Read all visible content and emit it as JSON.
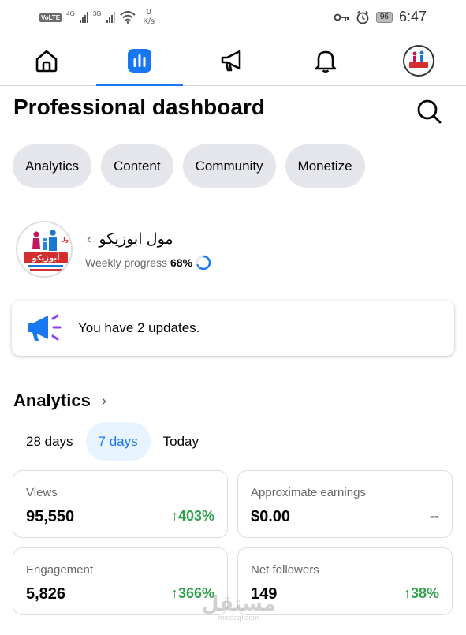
{
  "status_bar": {
    "volte": "VoLTE",
    "net1": "4G",
    "net2": "3G",
    "speed_value": "0",
    "speed_unit": "K/s",
    "battery": "96",
    "time": "6:47"
  },
  "nav": {
    "tabs": [
      {
        "icon": "home-icon"
      },
      {
        "icon": "dashboard-icon",
        "active": true
      },
      {
        "icon": "megaphone-icon"
      },
      {
        "icon": "bell-icon"
      },
      {
        "icon": "profile-avatar"
      }
    ],
    "accent": "#1877f2"
  },
  "header": {
    "title": "Professional dashboard"
  },
  "chips": [
    "Analytics",
    "Content",
    "Community",
    "Monetize"
  ],
  "profile": {
    "name": "مول ابوزيكو",
    "progress_label": "Weekly progress",
    "progress_value": "68%",
    "progress_fraction": 0.68,
    "avatar_lines": [
      "مول",
      "أبوزيكو"
    ]
  },
  "updates": {
    "text": "You have 2 updates."
  },
  "analytics": {
    "title": "Analytics",
    "ranges": [
      "28 days",
      "7 days",
      "Today"
    ],
    "active_range": "7 days",
    "cards": [
      {
        "label": "Views",
        "value": "95,550",
        "change": "↑403%"
      },
      {
        "label": "Approximate earnings",
        "value": "$0.00",
        "change": "--"
      },
      {
        "label": "Engagement",
        "value": "5,826",
        "change": "↑366%"
      },
      {
        "label": "Net followers",
        "value": "149",
        "change": "↑38%"
      }
    ],
    "positive_color": "#31a24c"
  },
  "watermark": {
    "text": "مستقل",
    "sub": "mostaql.com"
  }
}
